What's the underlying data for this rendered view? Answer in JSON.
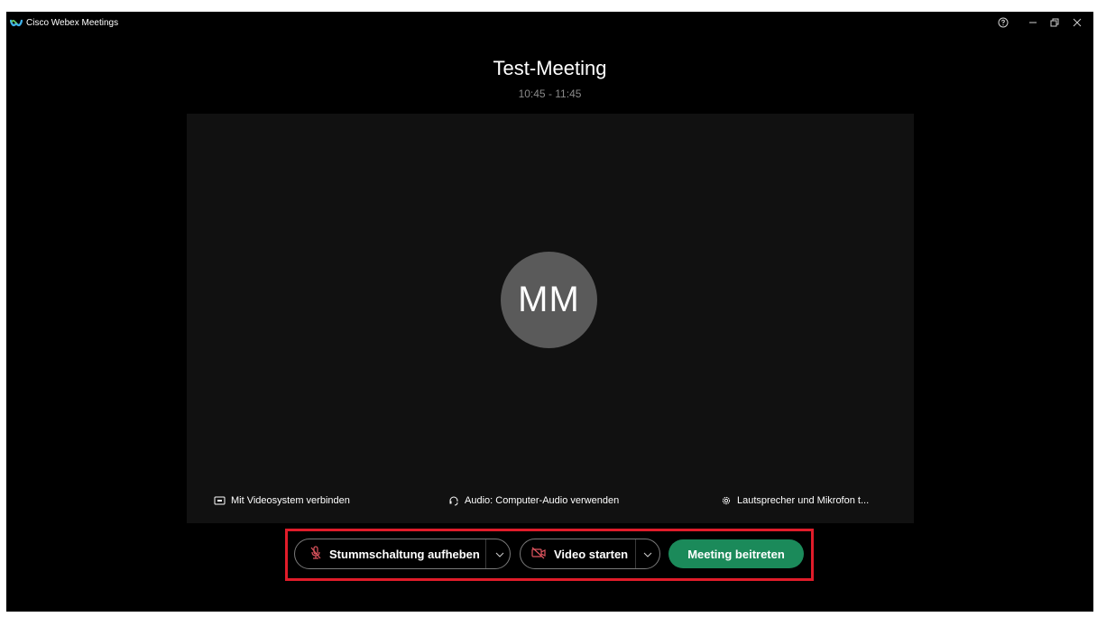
{
  "titlebar": {
    "app_title": "Cisco Webex Meetings",
    "help_icon": "help-circle-icon",
    "minimize_icon": "minimize-icon",
    "maximize_icon": "restore-icon",
    "close_icon": "close-icon"
  },
  "meeting": {
    "title": "Test-Meeting",
    "time": "10:45 - 11:45"
  },
  "preview": {
    "avatar_initials": "MM"
  },
  "options": {
    "video_system": "Mit Videosystem verbinden",
    "audio": "Audio: Computer-Audio verwenden",
    "speaker_mic": "Lautsprecher und Mikrofon t..."
  },
  "controls": {
    "mute_label": "Stummschaltung aufheben",
    "video_label": "Video starten",
    "join_label": "Meeting beitreten"
  },
  "colors": {
    "background": "#000000",
    "preview": "#111111",
    "avatar": "#5a5a5a",
    "join_button": "#1b8a5a",
    "muted_icon": "#e0555f",
    "highlight_border": "#e01c2a"
  }
}
